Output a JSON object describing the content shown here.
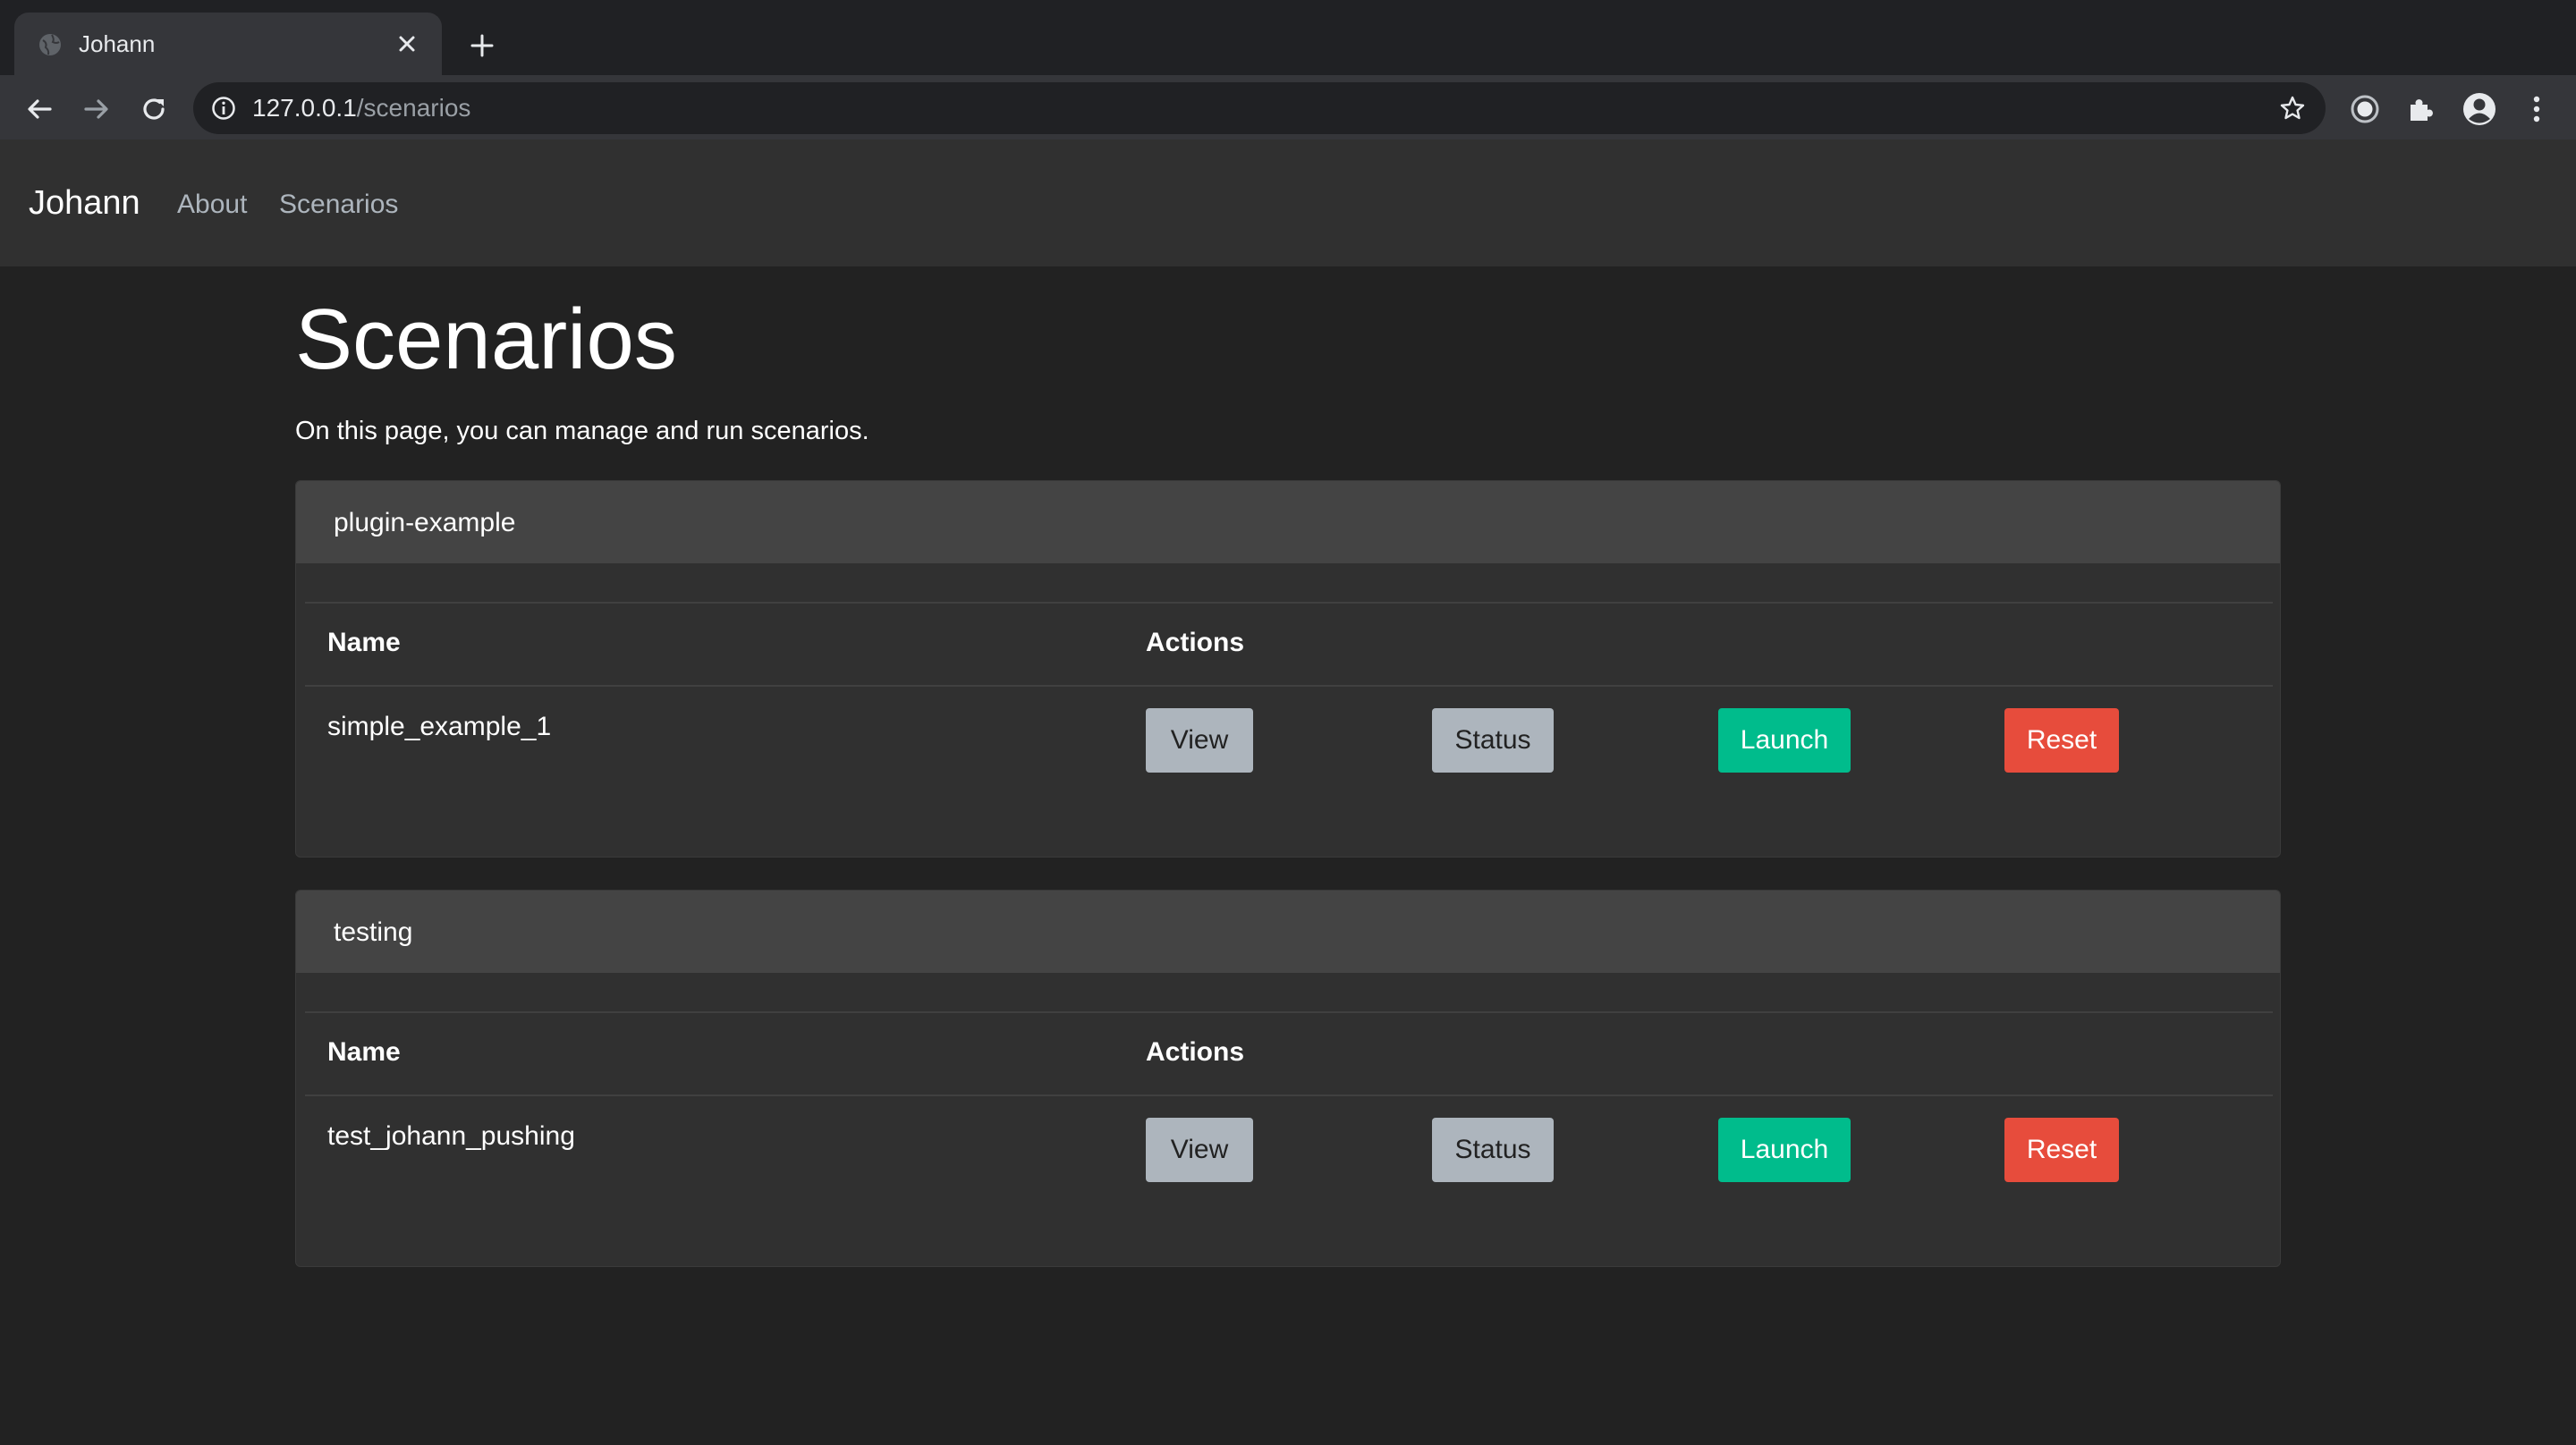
{
  "browser": {
    "tab_title": "Johann",
    "url_host": "127.0.0.1",
    "url_path": "/scenarios",
    "icons": [
      "globe-icon",
      "close-icon",
      "plus-icon",
      "back-arrow-icon",
      "forward-arrow-icon",
      "reload-icon",
      "info-icon",
      "star-icon",
      "record-icon",
      "puzzle-icon",
      "account-icon",
      "kebab-menu-icon"
    ]
  },
  "navbar": {
    "brand": "Johann",
    "links": [
      {
        "label": "About"
      },
      {
        "label": "Scenarios"
      }
    ]
  },
  "page": {
    "title": "Scenarios",
    "lead": "On this page, you can manage and run scenarios."
  },
  "table_headers": {
    "name": "Name",
    "actions": "Actions"
  },
  "buttons": {
    "view": "View",
    "status": "Status",
    "launch": "Launch",
    "reset": "Reset"
  },
  "colors": {
    "background": "#222222",
    "navbar": "#303030",
    "card_header": "#444444",
    "secondary_button": "#adb5bd",
    "success_button": "#00bc8c",
    "danger_button": "#e74c3c"
  },
  "cards": [
    {
      "header": "plugin-example",
      "rows": [
        {
          "name": "simple_example_1"
        }
      ]
    },
    {
      "header": "testing",
      "rows": [
        {
          "name": "test_johann_pushing"
        }
      ]
    }
  ]
}
